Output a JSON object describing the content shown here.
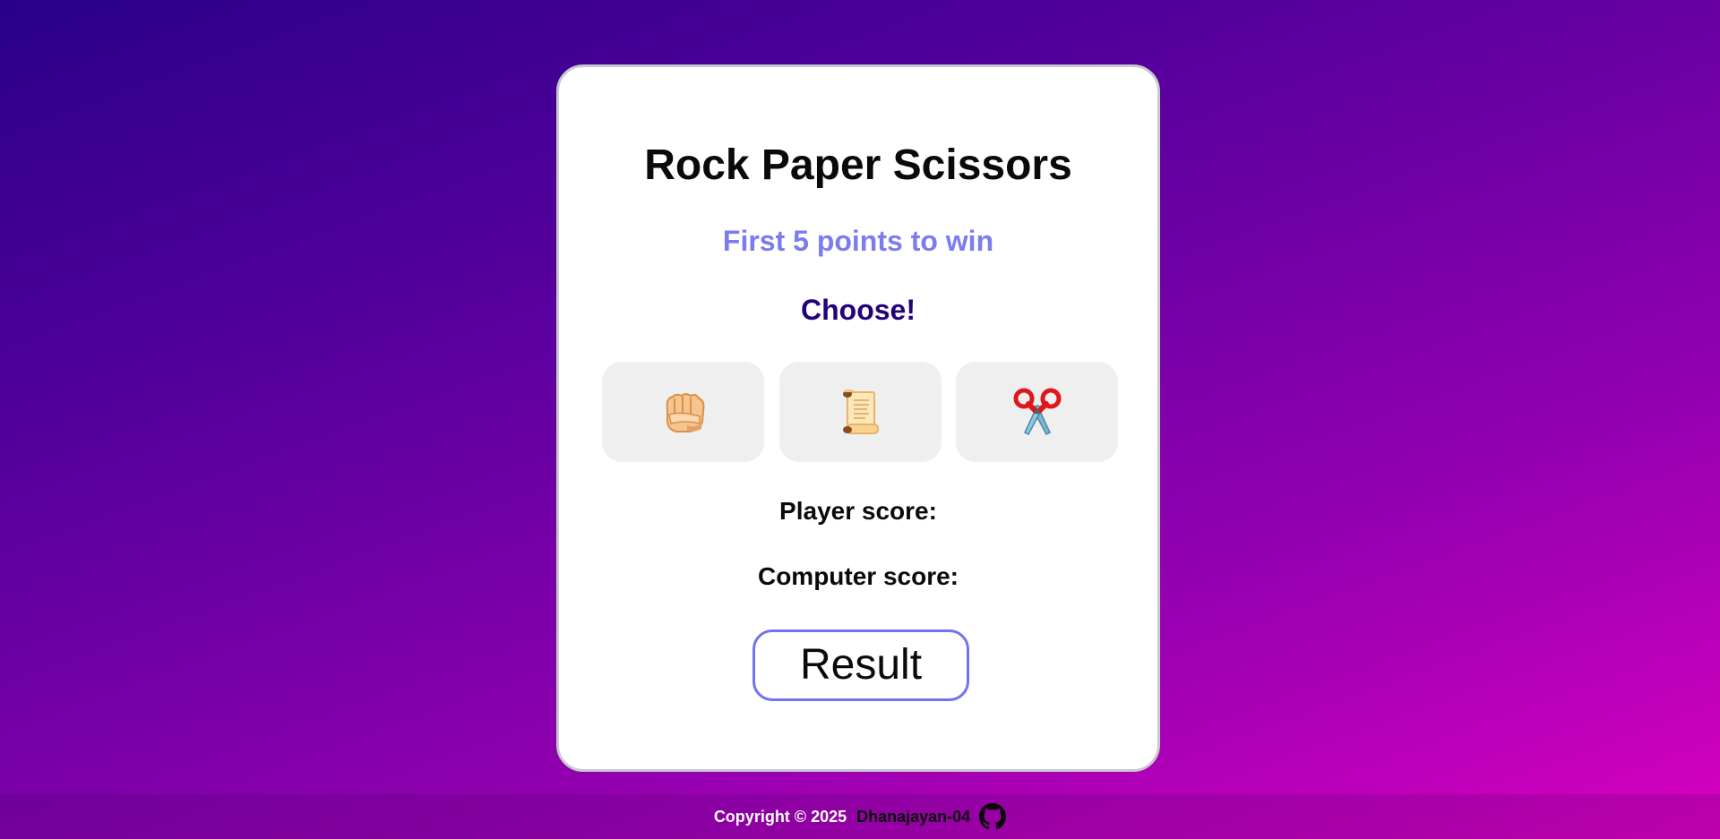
{
  "game": {
    "title": "Rock Paper Scissors",
    "subtitle": "First 5 points to win",
    "prompt": "Choose!",
    "choices": [
      {
        "name": "rock",
        "icon": "oncoming-fist-icon"
      },
      {
        "name": "paper",
        "icon": "scroll-icon"
      },
      {
        "name": "scissors",
        "icon": "scissors-icon"
      }
    ],
    "player_score_label": "Player score:",
    "computer_score_label": "Computer score:",
    "result_label": "Result"
  },
  "footer": {
    "copyright": "Copyright © 2025",
    "author": "Dhanajayan-04",
    "icon": "github-icon"
  },
  "colors": {
    "subtitle": "#7b7cf0",
    "prompt": "#24007a",
    "result_border": "#7273ee"
  }
}
